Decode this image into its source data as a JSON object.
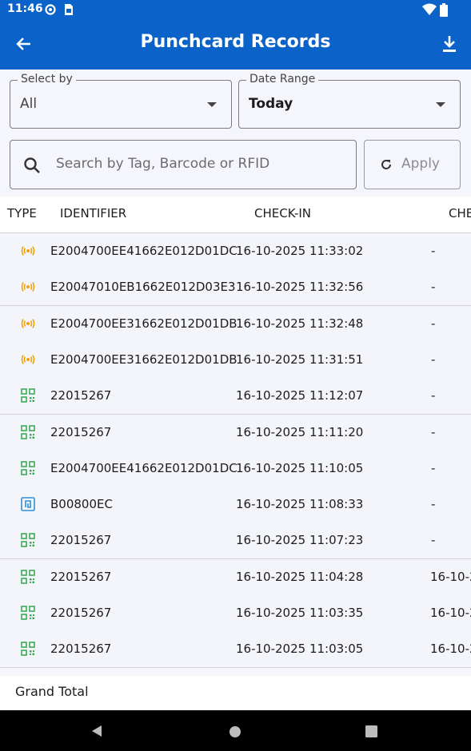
{
  "status_bar": {
    "time": "11:46"
  },
  "app_bar": {
    "title": "Punchcard Records"
  },
  "filters": {
    "select_by": {
      "label": "Select by",
      "value": "All"
    },
    "date_range": {
      "label": "Date Range",
      "value": "Today"
    }
  },
  "search": {
    "placeholder": "Search by Tag, Barcode or RFID",
    "value": ""
  },
  "apply_label": "Apply",
  "table": {
    "headers": {
      "type": "TYPE",
      "identifier": "IDENTIFIER",
      "checkin": "CHECK-IN",
      "checkout": "CHE"
    },
    "rows": [
      {
        "type": "rfid",
        "identifier": "E2004700EE41662E012D01DC",
        "checkin": "16-10-2025 11:33:02",
        "checkout": "-"
      },
      {
        "type": "rfid",
        "identifier": "E20047010EB1662E012D03E3",
        "checkin": "16-10-2025 11:32:56",
        "checkout": "-"
      },
      {
        "type": "rfid",
        "identifier": "E2004700EE31662E012D01DB",
        "checkin": "16-10-2025 11:32:48",
        "checkout": "-"
      },
      {
        "type": "rfid",
        "identifier": "E2004700EE31662E012D01DB",
        "checkin": "16-10-2025 11:31:51",
        "checkout": "-"
      },
      {
        "type": "qr",
        "identifier": "22015267",
        "checkin": "16-10-2025 11:12:07",
        "checkout": "-"
      },
      {
        "type": "qr",
        "identifier": "22015267",
        "checkin": "16-10-2025 11:11:20",
        "checkout": "-"
      },
      {
        "type": "qr",
        "identifier": "E2004700EE41662E012D01DC",
        "checkin": "16-10-2025 11:10:05",
        "checkout": "-"
      },
      {
        "type": "nfc",
        "identifier": "B00800EC",
        "checkin": "16-10-2025 11:08:33",
        "checkout": "-"
      },
      {
        "type": "qr",
        "identifier": "22015267",
        "checkin": "16-10-2025 11:07:23",
        "checkout": "-"
      },
      {
        "type": "qr",
        "identifier": "22015267",
        "checkin": "16-10-2025 11:04:28",
        "checkout": "16-10-2"
      },
      {
        "type": "qr",
        "identifier": "22015267",
        "checkin": "16-10-2025 11:03:35",
        "checkout": "16-10-2"
      },
      {
        "type": "qr",
        "identifier": "22015267",
        "checkin": "16-10-2025 11:03:05",
        "checkout": "16-10-2"
      }
    ]
  },
  "footer": {
    "grand_total_label": "Grand Total"
  },
  "colors": {
    "primary": "#0b63c9",
    "rfid_icon": "#f0a20a",
    "qr_icon": "#3cab55",
    "nfc_icon": "#2f8ed8"
  },
  "icons": {
    "rfid": "rfid-signal-icon",
    "qr": "qr-code-icon",
    "nfc": "nfc-tag-icon"
  }
}
